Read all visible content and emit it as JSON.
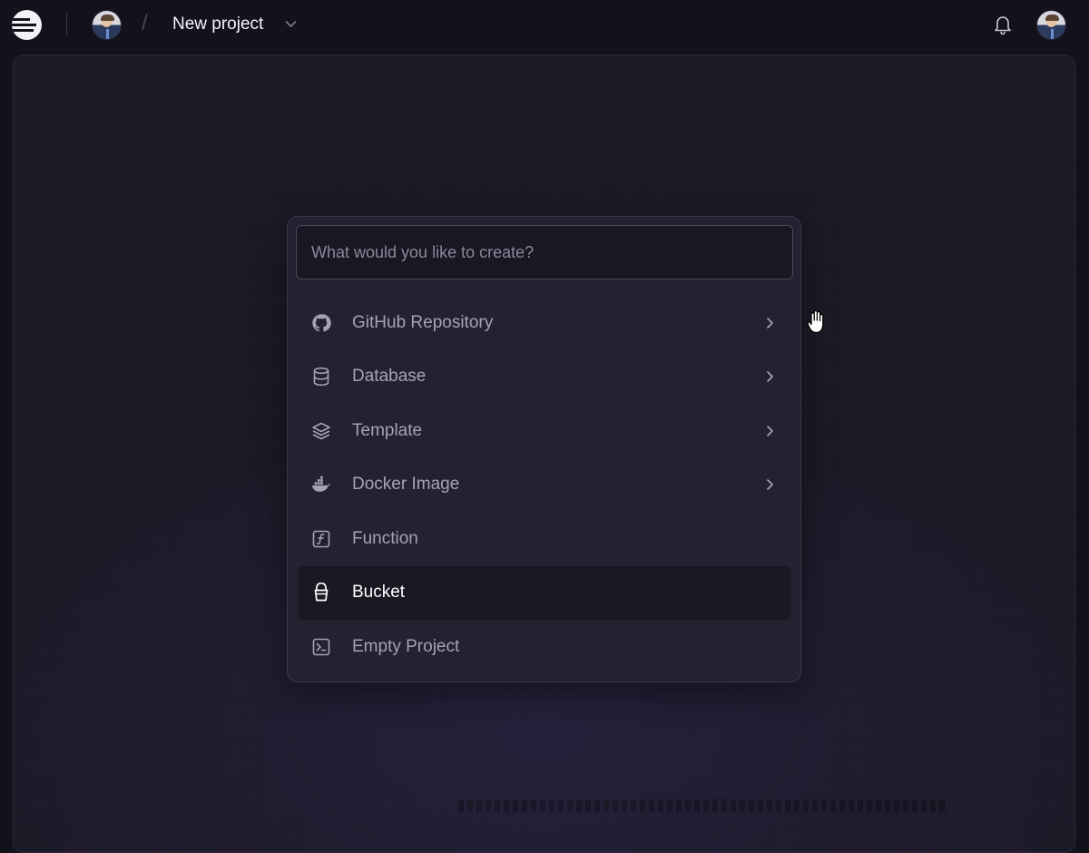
{
  "header": {
    "project_name": "New project",
    "icons": [
      "railway-logo-icon",
      "user-avatar-icon",
      "chevron-down-icon",
      "bell-icon",
      "user-avatar-icon"
    ]
  },
  "palette": {
    "search_placeholder": "What would you like to create?",
    "items": [
      {
        "label": "GitHub Repository",
        "icon": "github-icon",
        "has_submenu": true
      },
      {
        "label": "Database",
        "icon": "database-icon",
        "has_submenu": true
      },
      {
        "label": "Template",
        "icon": "layers-icon",
        "has_submenu": true
      },
      {
        "label": "Docker Image",
        "icon": "docker-icon",
        "has_submenu": true
      },
      {
        "label": "Function",
        "icon": "function-icon",
        "has_submenu": false
      },
      {
        "label": "Bucket",
        "icon": "bucket-icon",
        "has_submenu": false,
        "highlighted": true
      },
      {
        "label": "Empty Project",
        "icon": "terminal-icon",
        "has_submenu": false
      }
    ]
  },
  "colors": {
    "background": "#13111c",
    "canvas": "#1a1725",
    "palette_bg": "#252130",
    "highlight_bg": "#1b1824",
    "text_muted": "#a6a2b4",
    "text_active": "#ffffff"
  }
}
